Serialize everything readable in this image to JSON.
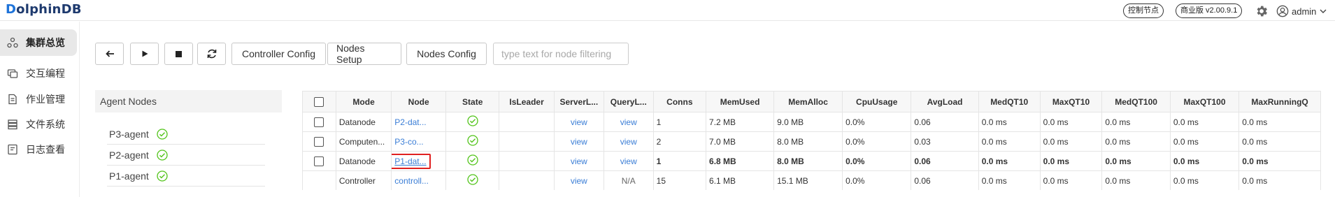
{
  "app": {
    "logo_b": "D",
    "logo_rest": "olphinDB"
  },
  "header": {
    "control_node": "控制节点",
    "version": "商业版 v2.00.9.1",
    "user": "admin"
  },
  "sidebar": {
    "items": [
      {
        "label": "集群总览",
        "icon": "cluster-icon",
        "active": true
      },
      {
        "label": "交互编程",
        "icon": "code-icon",
        "active": false
      },
      {
        "label": "作业管理",
        "icon": "job-icon",
        "active": false
      },
      {
        "label": "文件系统",
        "icon": "filesystem-icon",
        "active": false
      },
      {
        "label": "日志查看",
        "icon": "log-icon",
        "active": false
      }
    ]
  },
  "toolbar": {
    "controller_config": "Controller Config",
    "nodes_setup": "Nodes Setup",
    "nodes_config": "Nodes Config",
    "filter_placeholder": "type text for node filtering"
  },
  "agents": {
    "title": "Agent Nodes",
    "items": [
      "P3-agent",
      "P2-agent",
      "P1-agent"
    ]
  },
  "table": {
    "headers": [
      "",
      "Mode",
      "Node",
      "State",
      "IsLeader",
      "ServerL...",
      "QueryL...",
      "Conns",
      "MemUsed",
      "MemAlloc",
      "CpuUsage",
      "AvgLoad",
      "MedQT10",
      "MaxQT10",
      "MedQT100",
      "MaxQT100",
      "MaxRunningQ"
    ],
    "rows": [
      [
        "Datanode",
        "P2-dat...",
        "ok",
        "",
        "view",
        "view",
        "1",
        "7.2 MB",
        "9.0 MB",
        "0.0%",
        "0.06",
        "0.0 ms",
        "0.0 ms",
        "0.0 ms",
        "0.0 ms",
        "0.0 ms"
      ],
      [
        "Computen...",
        "P3-co...",
        "ok",
        "",
        "view",
        "view",
        "2",
        "7.0 MB",
        "8.0 MB",
        "0.0%",
        "0.03",
        "0.0 ms",
        "0.0 ms",
        "0.0 ms",
        "0.0 ms",
        "0.0 ms"
      ],
      [
        "Datanode",
        "P1-dat...",
        "ok",
        "",
        "view",
        "view",
        "1",
        "6.8 MB",
        "8.0 MB",
        "0.0%",
        "0.06",
        "0.0 ms",
        "0.0 ms",
        "0.0 ms",
        "0.0 ms",
        "0.0 ms"
      ],
      [
        "Controller",
        "controll...",
        "ok",
        "",
        "view",
        "N/A",
        "15",
        "6.1 MB",
        "15.1 MB",
        "0.0%",
        "0.06",
        "0.0 ms",
        "0.0 ms",
        "0.0 ms",
        "0.0 ms",
        "0.0 ms"
      ]
    ],
    "highlighted_row": 2,
    "ok_color": "#52c41a",
    "link_color": "#3b7ed6"
  }
}
